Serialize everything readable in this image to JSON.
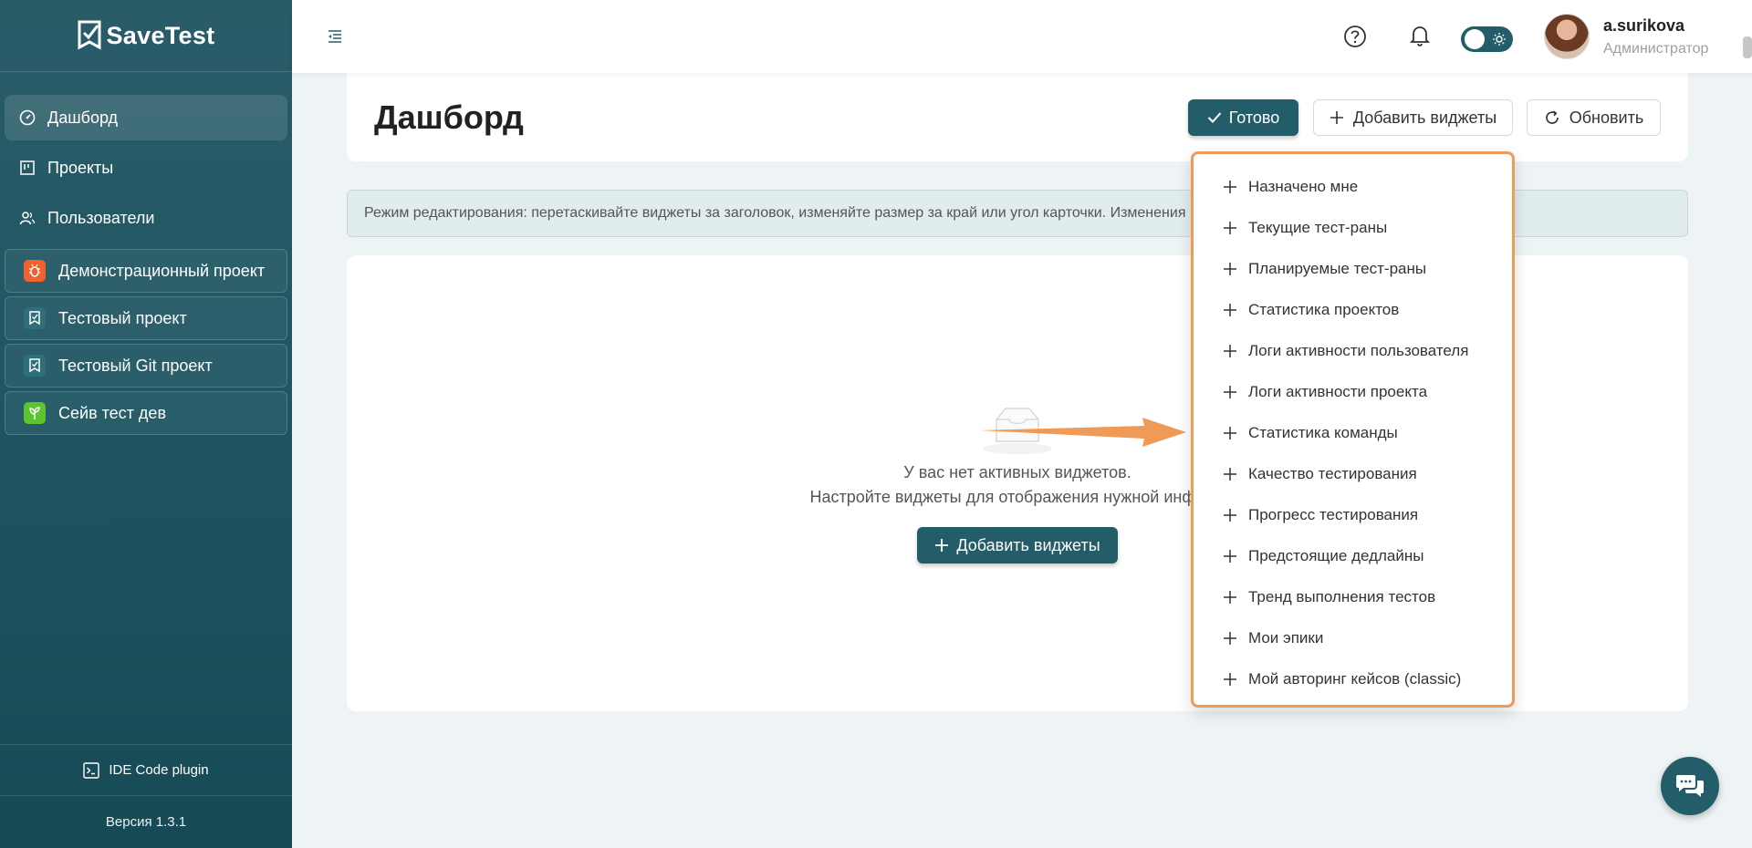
{
  "app": {
    "name": "SaveTest"
  },
  "sidebar": {
    "nav": [
      {
        "label": "Дашборд",
        "icon": "dashboard-icon",
        "active": true
      },
      {
        "label": "Проекты",
        "icon": "kanban-icon"
      },
      {
        "label": "Пользователи",
        "icon": "users-icon"
      }
    ],
    "projects": [
      {
        "label": "Демонстрационный проект",
        "icon": "bug-icon",
        "color": "#f0612e"
      },
      {
        "label": "Тестовый проект",
        "icon": "savetest-icon",
        "color": "#2f6f7c"
      },
      {
        "label": "Тестовый Git проект",
        "icon": "savetest-icon",
        "color": "#2f6f7c"
      },
      {
        "label": "Сейв тест дев",
        "icon": "sprout-icon",
        "color": "#5cc430"
      }
    ],
    "plugin_label": "IDE Code plugin",
    "version_label": "Версия 1.3.1"
  },
  "header": {
    "user_name": "a.surikova",
    "user_role": "Администратор"
  },
  "main": {
    "title": "Дашборд",
    "done_label": "Готово",
    "add_widgets_label": "Добавить виджеты",
    "refresh_label": "Обновить",
    "info_text": "Режим редактирования: перетаскивайте виджеты за заголовок, изменяйте размер за край или угол карточки. Изменения",
    "empty_line1": "У вас нет активных виджетов.",
    "empty_line2": "Настройте виджеты для отображения нужной информ",
    "empty_add_label": "Добавить виджеты"
  },
  "dropdown": {
    "items": [
      "Назначено мне",
      "Текущие тест-раны",
      "Планируемые тест-раны",
      "Статистика проектов",
      "Логи активности пользователя",
      "Логи активности проекта",
      "Статистика команды",
      "Качество тестирования",
      "Прогресс тестирования",
      "Предстоящие дедлайны",
      "Тренд выполнения тестов",
      "Мои эпики",
      "Мой авторинг кейсов (classic)"
    ]
  },
  "colors": {
    "primary": "#245d6a",
    "highlight": "#ef9a57"
  }
}
